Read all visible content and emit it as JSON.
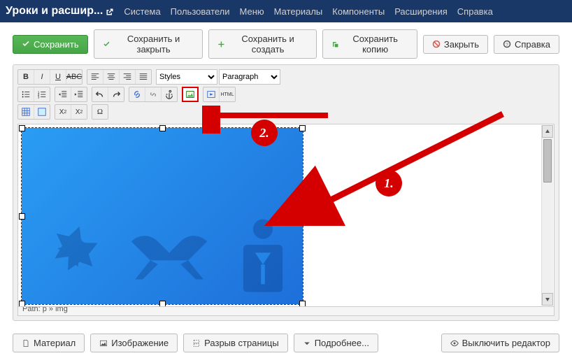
{
  "topbar": {
    "title": "Уроки и расшир...",
    "menu": [
      "Система",
      "Пользователи",
      "Меню",
      "Материалы",
      "Компоненты",
      "Расширения",
      "Справка"
    ]
  },
  "toolbar": {
    "save": "Сохранить",
    "save_close": "Сохранить и закрыть",
    "save_new": "Сохранить и создать",
    "save_copy": "Сохранить копию",
    "close": "Закрыть",
    "help": "Справка"
  },
  "editor": {
    "styles_label": "Styles",
    "paragraph_label": "Paragraph",
    "path_label": "Path: p » img"
  },
  "bottom": {
    "material": "Материал",
    "image": "Изображение",
    "pagebreak": "Разрыв страницы",
    "readmore": "Подробнее...",
    "toggle": "Выключить редактор"
  },
  "annotations": {
    "step1": "1.",
    "step2": "2."
  }
}
